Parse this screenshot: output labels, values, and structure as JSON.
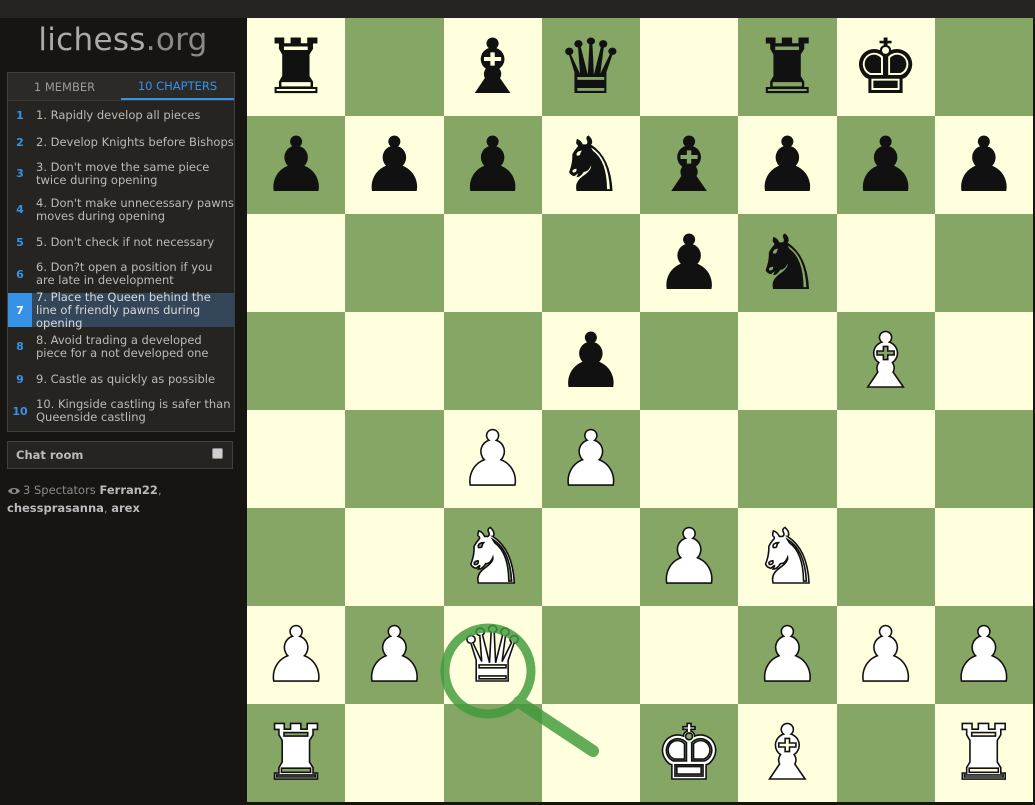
{
  "app": {
    "logo_main": "lichess",
    "logo_tld": ".org"
  },
  "study": {
    "tabs": [
      {
        "label": "1 MEMBER",
        "active": false
      },
      {
        "label": "10 CHAPTERS",
        "active": true
      }
    ],
    "chapters": [
      {
        "num": "1",
        "name": "1. Rapidly develop all pieces"
      },
      {
        "num": "2",
        "name": "2. Develop Knights before Bishops"
      },
      {
        "num": "3",
        "name": "3. Don't move the same piece twice during opening"
      },
      {
        "num": "4",
        "name": "4. Don't make unnecessary pawns moves during opening"
      },
      {
        "num": "5",
        "name": "5. Don't check if not necessary"
      },
      {
        "num": "6",
        "name": "6. Don?t open a position if you are late in development"
      },
      {
        "num": "7",
        "name": "7. Place the Queen behind the line of friendly pawns during opening"
      },
      {
        "num": "8",
        "name": "8. Avoid trading a developed piece for a not developed one"
      },
      {
        "num": "9",
        "name": "9. Castle as quickly as possible"
      },
      {
        "num": "10",
        "name": "10. Kingside castling is safer than Queenside castling"
      }
    ],
    "active_chapter": 7
  },
  "chat": {
    "title": "Chat room"
  },
  "spectators": {
    "count_label": "3 Spectators",
    "names": [
      "Ferran22",
      "chessprasanna",
      "arex"
    ]
  },
  "board": {
    "colors": {
      "light": "#ffffdd",
      "dark": "#86a666",
      "highlight": "#3f9a3a"
    },
    "rows": [
      [
        "r",
        "",
        "b",
        "q",
        "",
        "r",
        "k",
        ""
      ],
      [
        "p",
        "p",
        "p",
        "n",
        "b",
        "p",
        "p",
        "p"
      ],
      [
        "",
        "",
        "",
        "",
        "p",
        "n",
        "",
        ""
      ],
      [
        "",
        "",
        "",
        "p",
        "",
        "",
        "B",
        ""
      ],
      [
        "",
        "",
        "P",
        "P",
        "",
        "",
        "",
        ""
      ],
      [
        "",
        "",
        "N",
        "",
        "P",
        "N",
        "",
        ""
      ],
      [
        "P",
        "P",
        "Q",
        "",
        "",
        "P",
        "P",
        "P"
      ],
      [
        "R",
        "",
        "",
        "",
        "K",
        "B",
        "",
        "R"
      ]
    ],
    "highlight": {
      "square": "c2",
      "icon": "magnifier-icon"
    }
  }
}
